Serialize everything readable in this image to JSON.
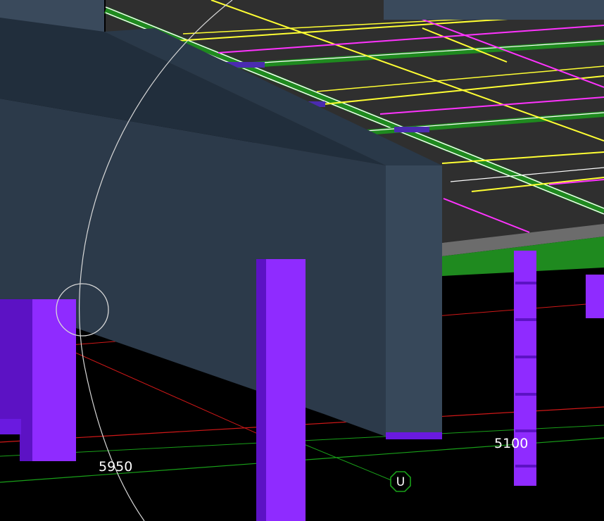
{
  "scene": {
    "background": "#000000",
    "colors": {
      "slab_top": "#2f2f2f",
      "slab_edge": "#6c6c6c",
      "wall": "#37485a",
      "wall_dark": "#212e3c",
      "column": "#8f2bff",
      "column_dark": "#5c12c4",
      "rebar_yellow": "#ffff33",
      "rebar_magenta": "#ff33ff",
      "rebar_white": "#ffffff",
      "rebar_green": "#1f8a1f",
      "grid_red": "#d01818",
      "grid_green": "#19a019"
    }
  },
  "dimensions": {
    "left": "5950",
    "right": "5100"
  },
  "grid_bubble": {
    "label": "U",
    "icon": "octagon-grid-bubble-icon"
  },
  "cursor": {
    "icon": "orbit-cursor-icon"
  },
  "direction_marker": {
    "icon": "arrow-left-icon"
  }
}
